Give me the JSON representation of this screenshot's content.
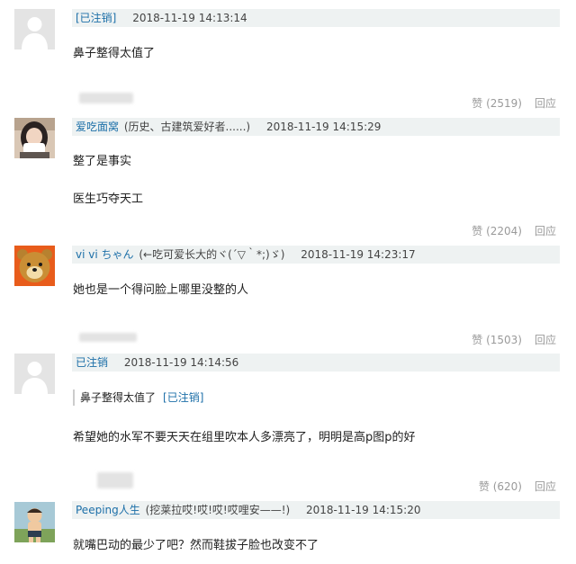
{
  "comments": [
    {
      "username": "[已注销]",
      "tagline": "",
      "time": "2018-11-19 14:13:14",
      "quote_text": "",
      "quote_user": "",
      "lines": [
        "鼻子整得太值了"
      ],
      "likes": "赞 (2519)",
      "reply": "回应",
      "avatar_icon": "default-user-icon"
    },
    {
      "username": "爱吃面窝",
      "tagline": "(历史、古建筑爱好者......)",
      "time": "2018-11-19 14:15:29",
      "quote_text": "",
      "quote_user": "",
      "lines": [
        "整了是事实",
        "医生巧夺天工"
      ],
      "likes": "赞 (2204)",
      "reply": "回应",
      "avatar_icon": "girl-photo-avatar"
    },
    {
      "username": "vi vi ちゃん",
      "tagline": "(←吃可爱长大的ヾ(´▽｀*;)ゞ)",
      "time": "2018-11-19 14:23:17",
      "quote_text": "",
      "quote_user": "",
      "lines": [
        "她也是一个得问脸上哪里没整的人"
      ],
      "likes": "赞 (1503)",
      "reply": "回应",
      "avatar_icon": "bear-cartoon-avatar"
    },
    {
      "username": "已注销",
      "tagline": "",
      "time": "2018-11-19 14:14:56",
      "quote_text": "鼻子整得太值了",
      "quote_user": "[已注销]",
      "lines": [
        "希望她的水军不要天天在组里吹本人多漂亮了，明明是高p图p的好"
      ],
      "likes": "赞 (620)",
      "reply": "回应",
      "avatar_icon": "default-user-icon"
    },
    {
      "username": "Peeping人生",
      "tagline": "(挖莱拉哎!哎!哎!哎哩安——!)",
      "time": "2018-11-19 14:15:20",
      "quote_text": "",
      "quote_user": "",
      "lines": [
        "就嘴巴动的最少了吧？然而鞋拔子脸也改变不了"
      ],
      "likes": "",
      "reply": "",
      "avatar_icon": "cartoon-boy-avatar"
    }
  ],
  "colors": {
    "username": "#1c6fa8",
    "header_bg": "#eef2f2",
    "footer_text": "#9a9a9a"
  }
}
